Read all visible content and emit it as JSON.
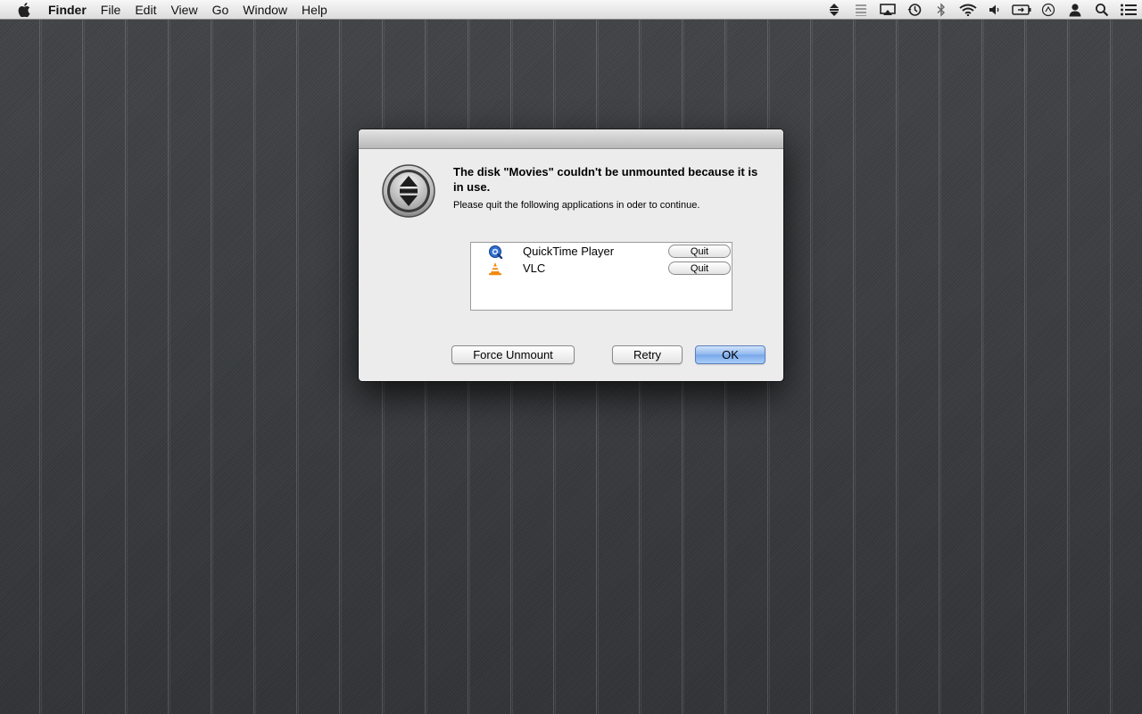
{
  "menubar": {
    "app_name": "Finder",
    "menus": [
      "File",
      "Edit",
      "View",
      "Go",
      "Window",
      "Help"
    ],
    "status_icons": [
      "eject-icon",
      "input-menu-icon",
      "airplay-icon",
      "time-machine-icon",
      "bluetooth-icon",
      "wifi-icon",
      "volume-icon",
      "battery-icon",
      "activity-icon",
      "user-icon",
      "spotlight-icon",
      "notification-center-icon"
    ]
  },
  "dialog": {
    "message": "The disk \"Movies\" couldn't be unmounted because it is in use.",
    "informative": "Please quit the following applications in oder to continue.",
    "apps": [
      {
        "name": "QuickTime Player",
        "quit_label": "Quit",
        "icon": "quicktime-icon"
      },
      {
        "name": "VLC",
        "quit_label": "Quit",
        "icon": "vlc-icon"
      }
    ],
    "buttons": {
      "force_unmount": "Force Unmount",
      "retry": "Retry",
      "ok": "OK"
    }
  },
  "colors": {
    "default_button": "#78a7ea",
    "dialog_bg": "#ececec",
    "desktop_bg": "#3a3b3c"
  }
}
